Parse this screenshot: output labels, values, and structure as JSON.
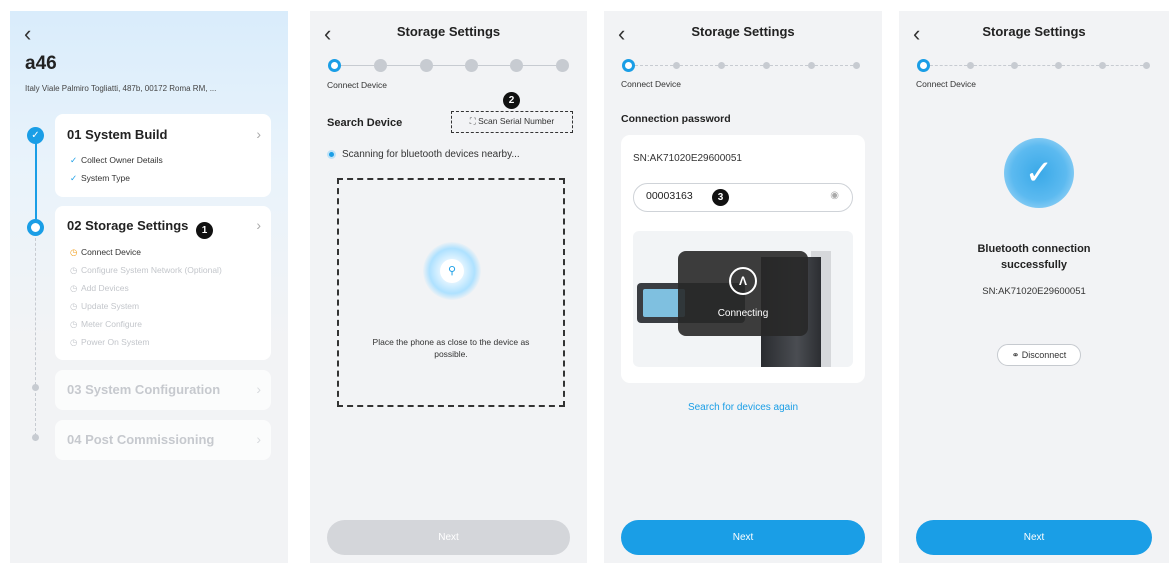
{
  "colors": {
    "accent": "#1a9ee6",
    "disabled": "#d4d6da",
    "callout": "#111111"
  },
  "panel1": {
    "back_icon": "chevron-left-icon",
    "site_name": "a46",
    "address": "Italy Viale Palmiro Togliatti, 487b, 00172 Roma RM, ...",
    "steps": [
      {
        "title": "01 System Build",
        "items": [
          "Collect Owner Details",
          "System Type"
        ]
      },
      {
        "title": "02 Storage Settings",
        "items": [
          "Connect Device",
          "Configure System Network (Optional)",
          "Add Devices",
          "Update System",
          "Meter Configure",
          "Power On System"
        ]
      },
      {
        "title": "03 System Configuration"
      },
      {
        "title": "04 Post Commissioning"
      }
    ],
    "callout": "1"
  },
  "panel2": {
    "title": "Storage Settings",
    "step_label": "Connect Device",
    "search_label": "Search Device",
    "scan_button": "Scan Serial Number",
    "scanning_text": "Scanning for bluetooth devices nearby...",
    "hint": "Place the phone as close to the device as possible.",
    "next": "Next",
    "callout": "2"
  },
  "panel3": {
    "title": "Storage Settings",
    "step_label": "Connect Device",
    "section_label": "Connection password",
    "sn": "SN:AK71020E29600051",
    "password": "00003163",
    "connecting": "Connecting",
    "search_again": "Search for devices again",
    "next": "Next",
    "callout": "3"
  },
  "panel4": {
    "title": "Storage Settings",
    "step_label": "Connect Device",
    "success_line1": "Bluetooth connection",
    "success_line2": "successfully",
    "sn": "SN:AK71020E29600051",
    "disconnect": "Disconnect",
    "next": "Next"
  }
}
